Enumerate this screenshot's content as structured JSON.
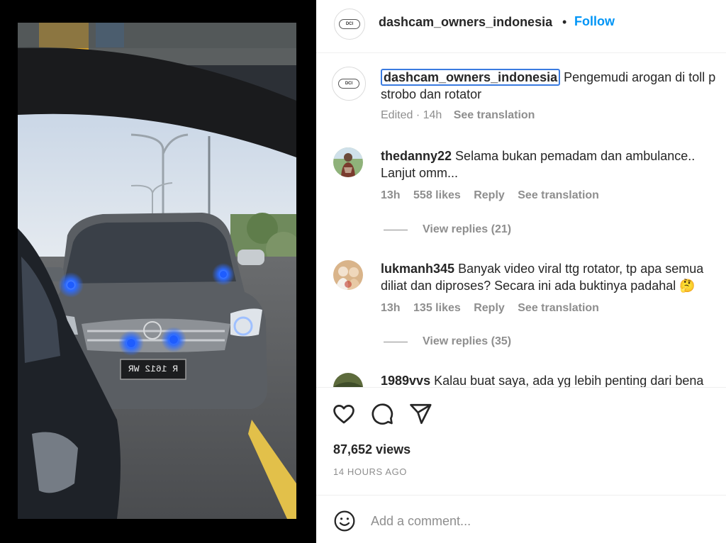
{
  "post": {
    "username": "dashcam_owners_indonesia",
    "separator": "•",
    "follow_label": "Follow",
    "caption_text": "Pengemudi arogan di toll p",
    "caption_line2": "strobo dan rotator",
    "caption_edited": "Edited · 14h",
    "caption_see_translation": "See translation"
  },
  "comments": [
    {
      "username": "thedanny22",
      "text": "Selama bukan pemadam dan ambulance..",
      "text_line2": "Lanjut omm...",
      "time": "13h",
      "likes": "558 likes",
      "reply_label": "Reply",
      "see_translation": "See translation",
      "view_replies": "View replies (21)"
    },
    {
      "username": "lukmanh345",
      "text": "Banyak video viral ttg rotator, tp apa semua",
      "text_line2": "diliat dan diproses? Secara ini ada buktinya padahal 🤔",
      "time": "13h",
      "likes": "135 likes",
      "reply_label": "Reply",
      "see_translation": "See translation",
      "view_replies": "View replies (35)"
    },
    {
      "username": "1989vvs",
      "text": "Kalau buat saya, ada yg lebih penting dari bena"
    }
  ],
  "stats": {
    "views": "87,652 views",
    "posted_ago": "14 HOURS AGO"
  },
  "composer": {
    "placeholder": "Add a comment..."
  },
  "media": {
    "plate_text": "R 1612 WR"
  },
  "colors": {
    "accent": "#0095f6",
    "muted": "#8e8e8e",
    "text": "#262626",
    "selection_outline": "#3a7be0",
    "strobe_blue": "#1e5cff"
  }
}
